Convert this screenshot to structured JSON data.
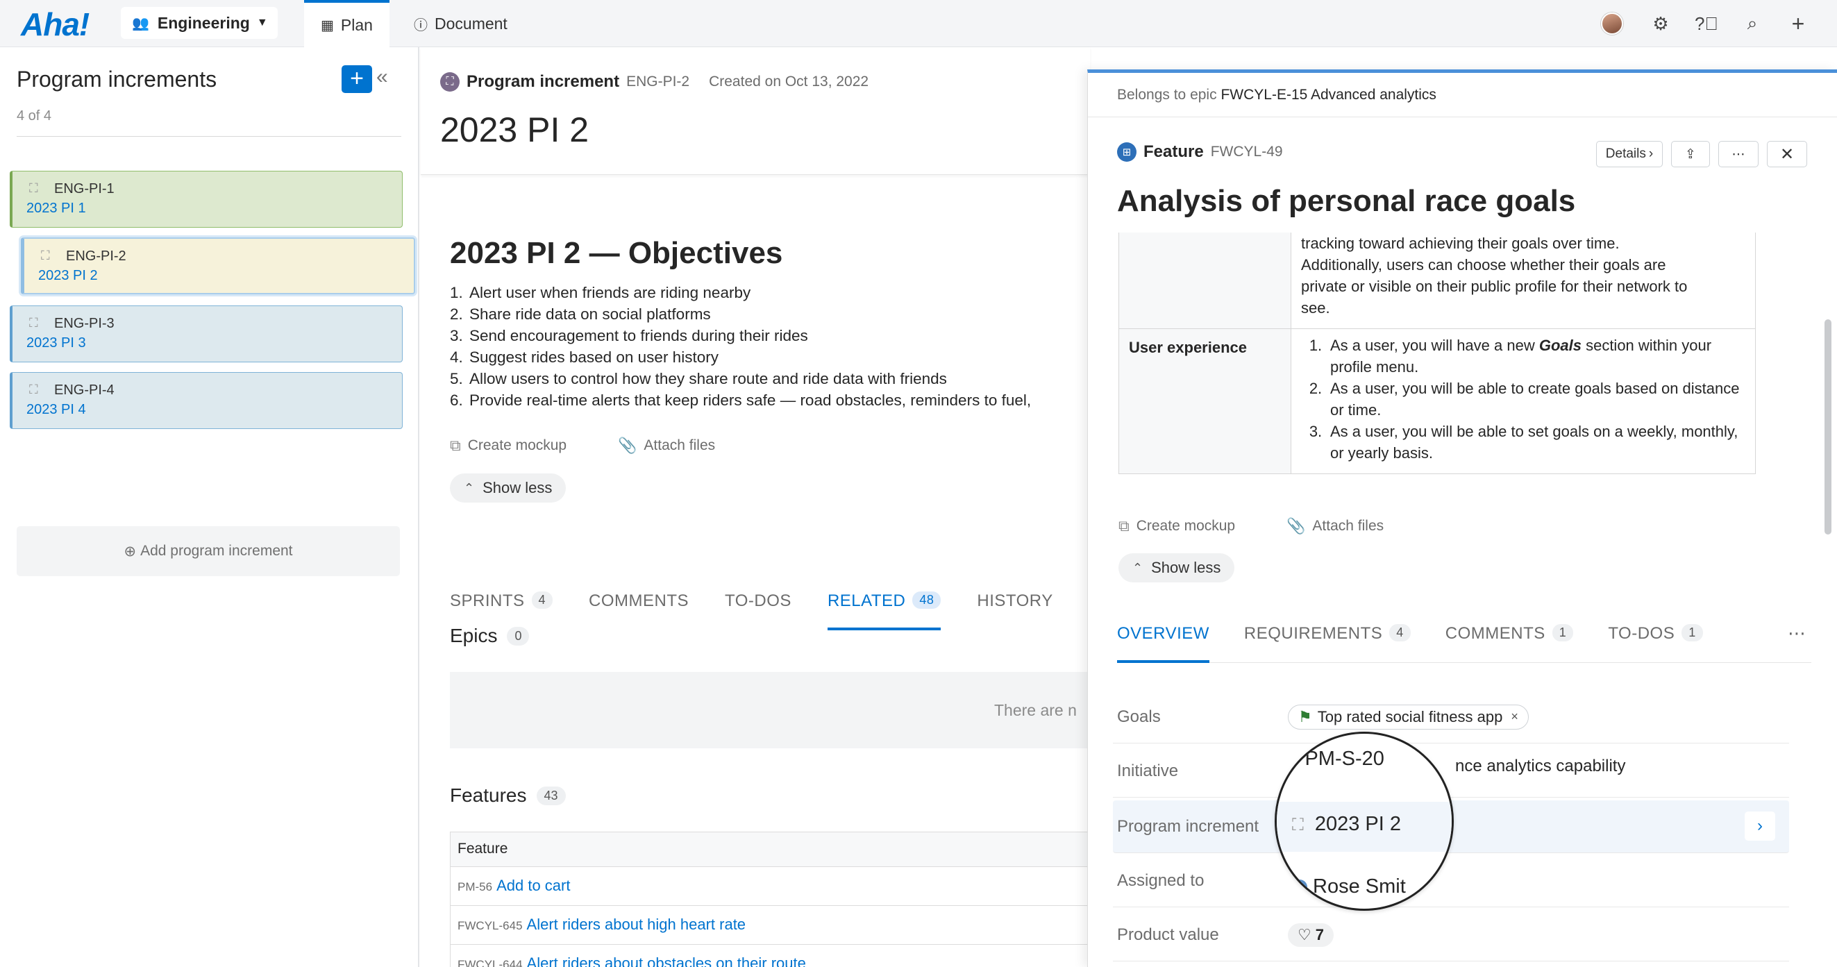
{
  "topbar": {
    "logo": "Aha!",
    "workspace": "Engineering",
    "nav": [
      {
        "label": "Plan",
        "active": true
      },
      {
        "label": "Document",
        "active": false
      }
    ]
  },
  "sidebar": {
    "title": "Program increments",
    "count": "4 of 4",
    "items": [
      {
        "id": "ENG-PI-1",
        "name": "2023 PI 1",
        "color": "#dde9cf"
      },
      {
        "id": "ENG-PI-2",
        "name": "2023 PI 2",
        "color": "#f6f2da"
      },
      {
        "id": "ENG-PI-3",
        "name": "2023 PI 3",
        "color": "#dde9ee"
      },
      {
        "id": "ENG-PI-4",
        "name": "2023 PI 4",
        "color": "#dde9ee"
      }
    ],
    "add_label": "Add program increment"
  },
  "record": {
    "type": "Program increment",
    "ref": "ENG-PI-2",
    "created": "Created on Oct 13, 2022",
    "title": "2023 PI 2",
    "objectives_title": "2023 PI 2 — Objectives",
    "objectives": [
      "Alert user when friends are riding nearby",
      "Share ride data on social platforms",
      "Send encouragement to friends during their rides",
      "Suggest rides based on user history",
      "Allow users to control how they share route and ride data with friends",
      "Provide real-time alerts that keep riders safe — road obstacles, reminders to fuel,"
    ],
    "create_mockup": "Create mockup",
    "attach_files": "Attach files",
    "show_less": "Show less",
    "tabs": [
      {
        "label": "SPRINTS",
        "count": "4"
      },
      {
        "label": "COMMENTS",
        "count": ""
      },
      {
        "label": "TO-DOS",
        "count": ""
      },
      {
        "label": "RELATED",
        "count": "48"
      },
      {
        "label": "HISTORY",
        "count": ""
      }
    ],
    "epics": {
      "label": "Epics",
      "count": "0",
      "empty": "There are n"
    },
    "features": {
      "label": "Features",
      "count": "43",
      "column": "Feature",
      "rows": [
        {
          "ref": "PM-56",
          "name": "Add to cart"
        },
        {
          "ref": "FWCYL-645",
          "name": "Alert riders about high heart rate"
        },
        {
          "ref": "FWCYL-644",
          "name": "Alert riders about obstacles on their route"
        }
      ]
    }
  },
  "drawer": {
    "epic_prefix": "Belongs to epic",
    "epic": "FWCYL-E-15 Advanced analytics",
    "type": "Feature",
    "ref": "FWCYL-49",
    "details_label": "Details",
    "title": "Analysis of personal race goals",
    "desc_lines": [
      "tracking toward achieving their goals over time.",
      "Additionally, users can choose whether their goals are",
      "private or visible on their public profile for their network to",
      "see."
    ],
    "ux_label": "User experience",
    "ux_items": [
      {
        "n": "1.",
        "pre": "As a user, you will have a new ",
        "em": "Goals",
        "post": " section within your profile menu."
      },
      {
        "n": "2.",
        "pre": "As a user, you will be able to create goals based on distance or time.",
        "em": "",
        "post": ""
      },
      {
        "n": "3.",
        "pre": "As a user, you will be able to set goals on a weekly, monthly, or yearly basis.",
        "em": "",
        "post": ""
      }
    ],
    "create_mockup": "Create mockup",
    "attach_files": "Attach files",
    "show_less": "Show less",
    "tabs": [
      {
        "label": "OVERVIEW",
        "count": ""
      },
      {
        "label": "REQUIREMENTS",
        "count": "4"
      },
      {
        "label": "COMMENTS",
        "count": "1"
      },
      {
        "label": "TO-DOS",
        "count": "1"
      }
    ],
    "fields": {
      "goals_label": "Goals",
      "goal_tag": "Top rated social fitness app",
      "initiative_label": "Initiative",
      "initiative_ref": "PM-S-20",
      "initiative_rest": "nce analytics capability",
      "pi_label": "Program increment",
      "pi_value": "2023 PI 2",
      "assigned_label": "Assigned to",
      "assigned_value": "Rose Smit",
      "value_label": "Product value",
      "value_score": "7"
    }
  }
}
